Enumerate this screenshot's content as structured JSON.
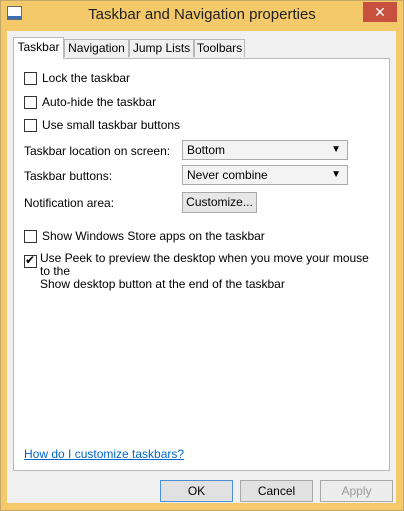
{
  "window": {
    "title": "Taskbar and Navigation properties",
    "close_label": "✕"
  },
  "tabs": [
    {
      "label": "Taskbar",
      "active": true
    },
    {
      "label": "Navigation",
      "active": false
    },
    {
      "label": "Jump Lists",
      "active": false
    },
    {
      "label": "Toolbars",
      "active": false
    }
  ],
  "checkboxes": {
    "lock": {
      "label": "Lock the taskbar",
      "checked": false
    },
    "autohide": {
      "label": "Auto-hide the taskbar",
      "checked": false
    },
    "small_buttons": {
      "label": "Use small taskbar buttons",
      "checked": false
    },
    "store_apps": {
      "label": "Show Windows Store apps on the taskbar",
      "checked": false
    },
    "peek": {
      "label_line1": "Use Peek to preview the desktop when you move your mouse to the",
      "label_line2": "Show desktop button at the end of the taskbar",
      "checked": true
    }
  },
  "fields": {
    "location_label": "Taskbar location on screen:",
    "location_value": "Bottom",
    "buttons_label": "Taskbar buttons:",
    "buttons_value": "Never combine",
    "notification_label": "Notification area:",
    "customize_label": "Customize..."
  },
  "help_link": "How do I customize taskbars?",
  "footer": {
    "ok": "OK",
    "cancel": "Cancel",
    "apply": "Apply"
  },
  "colors": {
    "title_bar": "#f4c96a",
    "close": "#c7503f",
    "link": "#0066cc"
  },
  "icons": {
    "app": "taskbar-properties-icon",
    "close": "close-icon",
    "dropdown": "chevron-down-icon",
    "check": "checkmark-icon"
  }
}
